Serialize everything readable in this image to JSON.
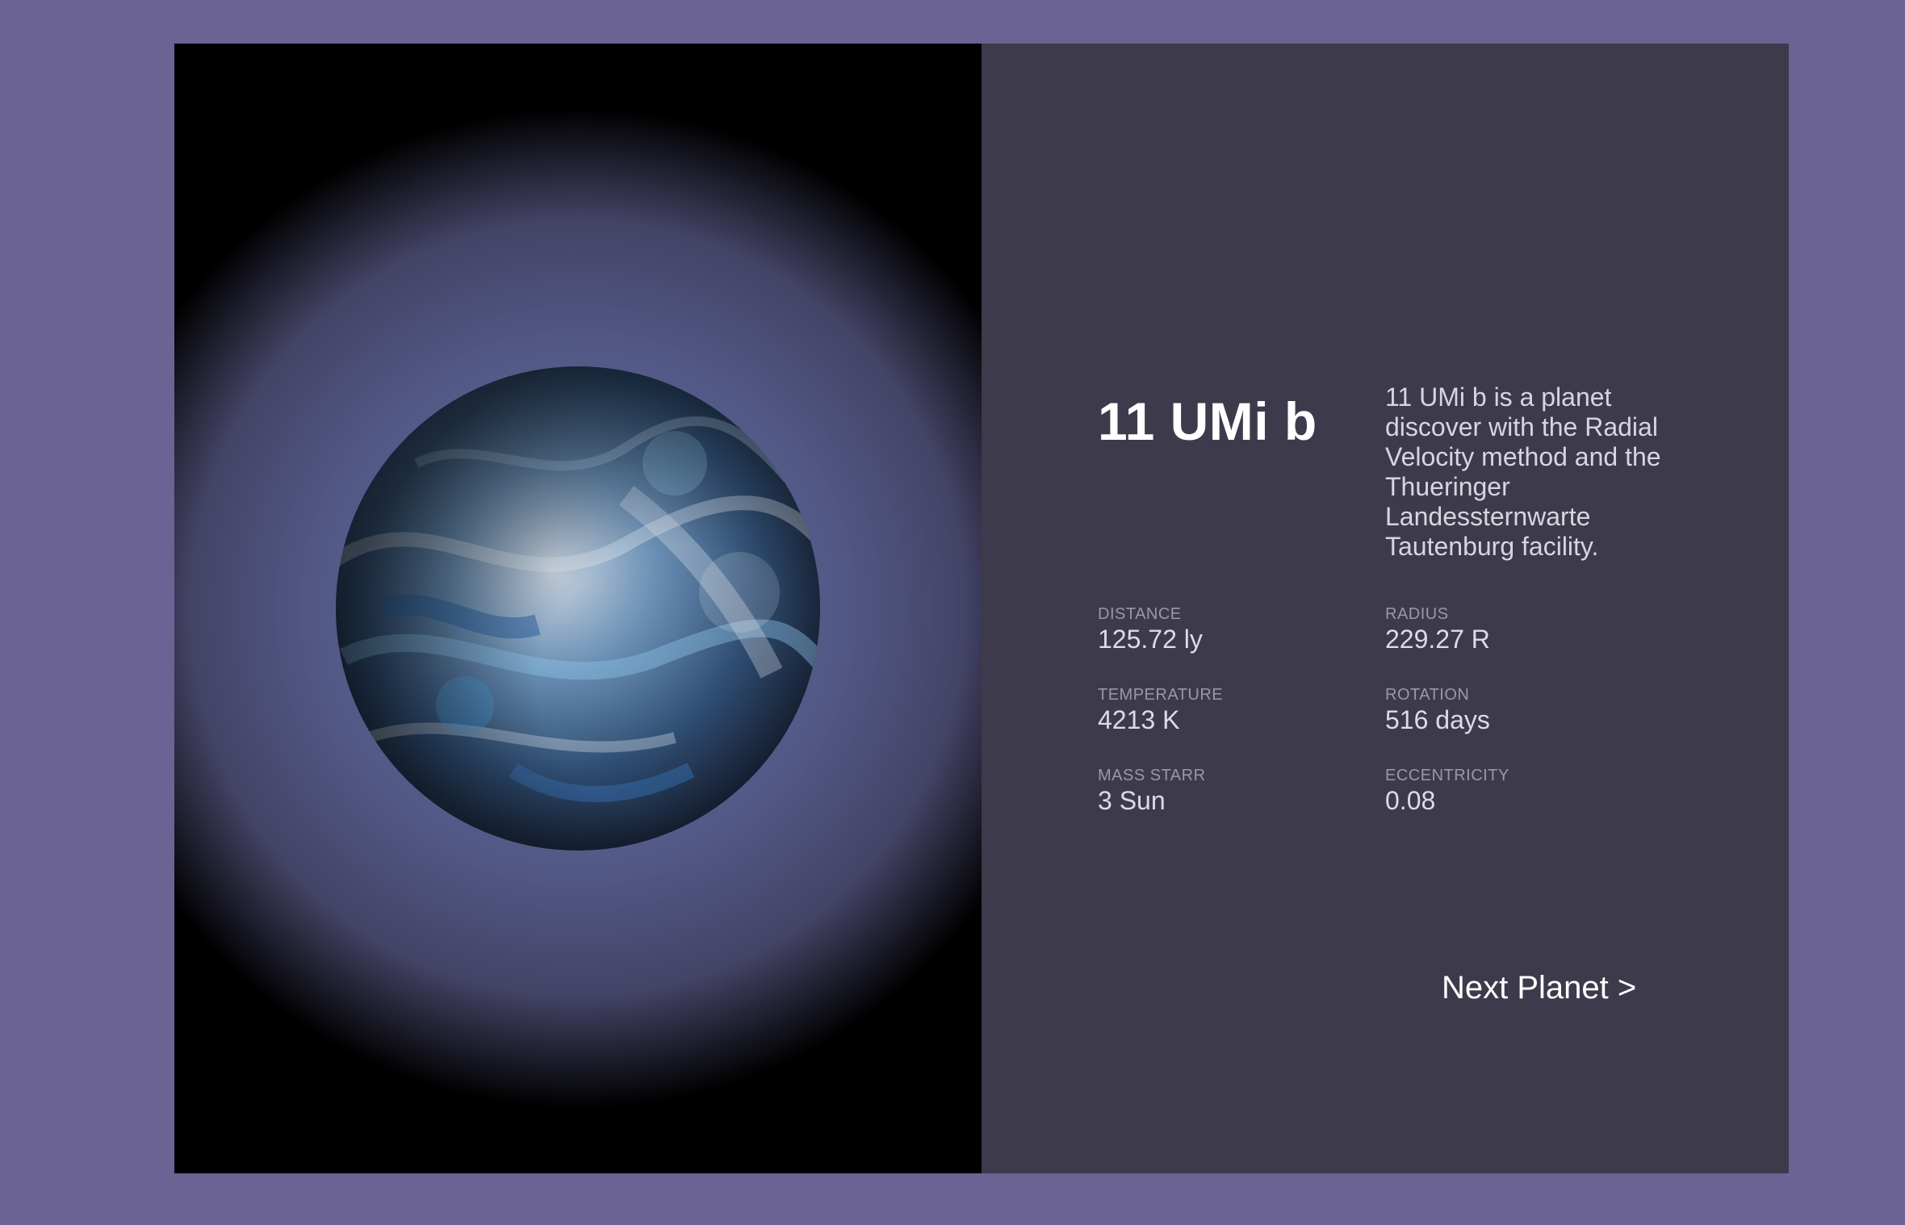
{
  "planet": {
    "name": "11 UMi b",
    "description": "11 UMi b is a planet discover with the Radial Velocity method and the Thueringer Landessternwarte Tautenburg facility."
  },
  "stats": [
    {
      "label": "DISTANCE",
      "value": "125.72 ly"
    },
    {
      "label": "RADIUS",
      "value": "229.27 R"
    },
    {
      "label": "TEMPERATURE",
      "value": "4213 K"
    },
    {
      "label": "ROTATION",
      "value": "516 days"
    },
    {
      "label": "MASS STARR",
      "value": "3 Sun"
    },
    {
      "label": "ECCENTRICITY",
      "value": "0.08"
    }
  ],
  "navigation": {
    "next_label": "Next Planet >"
  },
  "colors": {
    "page_background": "#6a6393",
    "info_panel": "#3d3b4b",
    "visual_panel": "#000000",
    "planet_tint": "#4a8fc4"
  }
}
